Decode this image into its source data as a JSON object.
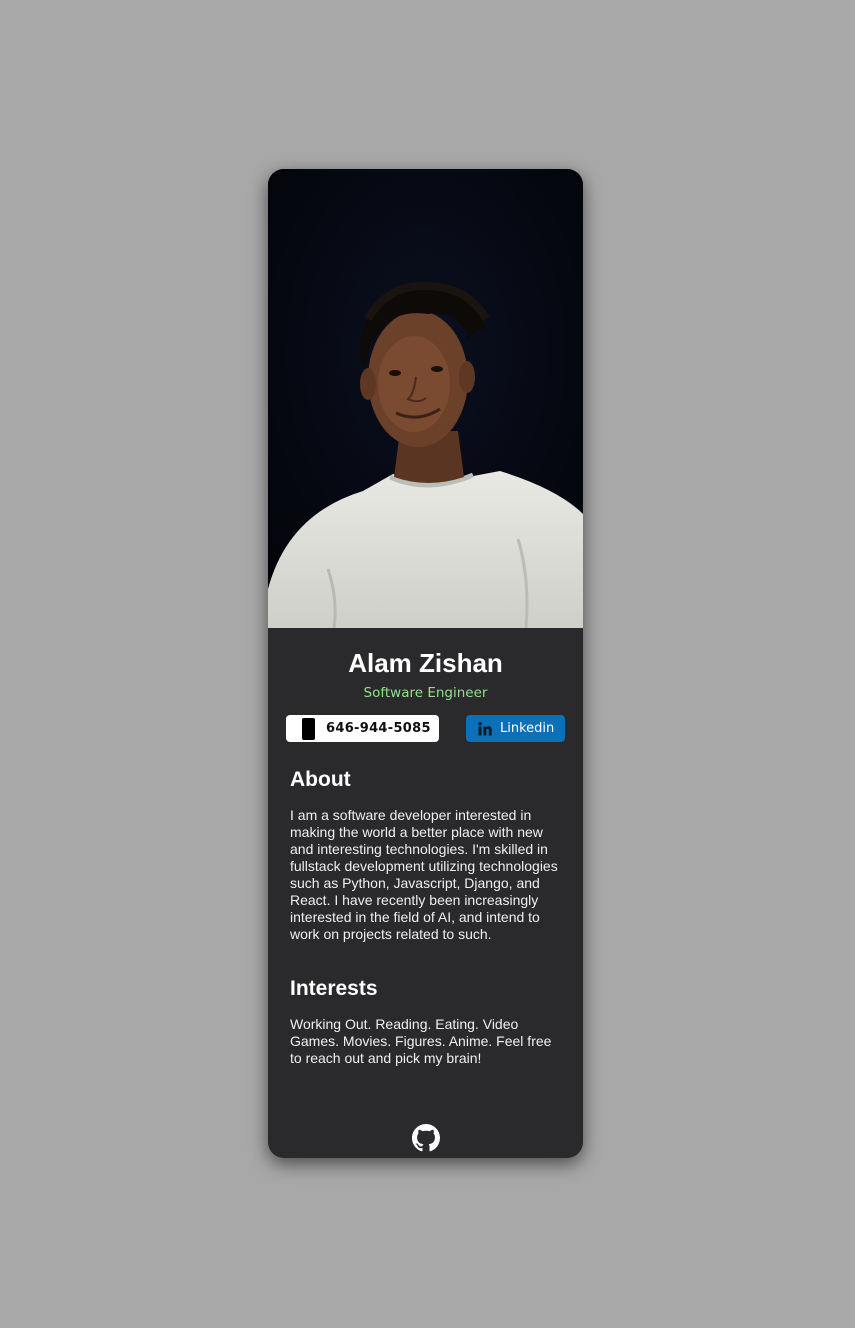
{
  "profile": {
    "name": "Alam Zishan",
    "title": "Software Engineer"
  },
  "contact": {
    "phone": "646-944-5085",
    "linkedin_label": "Linkedin"
  },
  "about": {
    "heading": "About",
    "text": "I am a software developer interested in making the world a better place with new and interesting technologies. I'm skilled in fullstack development utilizing technologies such as Python, Javascript, Django, and React. I have recently been increasingly interested in the field of AI, and intend to work on projects related to such."
  },
  "interests": {
    "heading": "Interests",
    "text": "Working Out. Reading. Eating. Video Games. Movies. Figures. Anime. Feel free to reach out and pick my brain!"
  },
  "icons": {
    "phone": "phone-icon",
    "linkedin": "linkedin-icon",
    "github": "github-icon"
  },
  "colors": {
    "background": "#a8a8a8",
    "card": "#2a292b",
    "accent_title": "#8fe28a",
    "linkedin": "#0a71b9"
  }
}
